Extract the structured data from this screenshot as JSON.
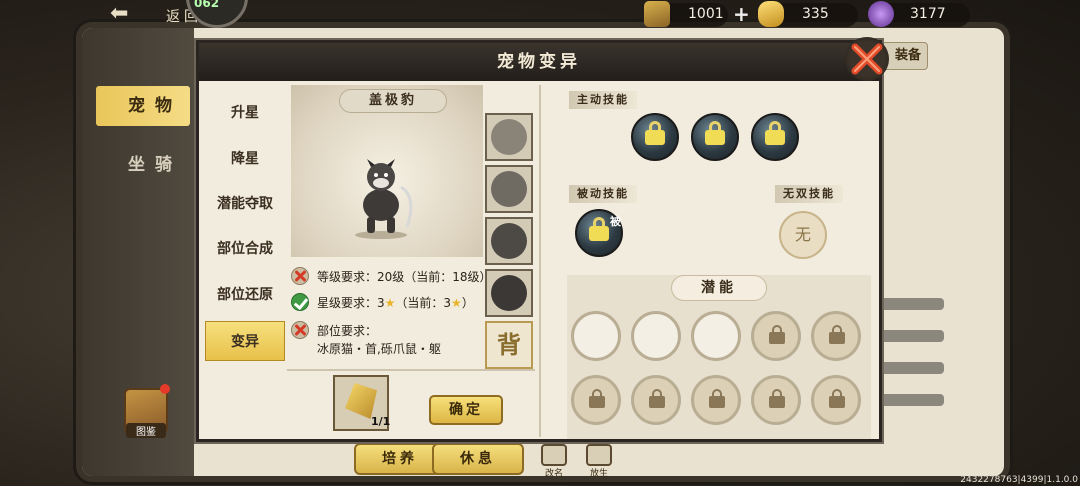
{
  "hud": {
    "back_label": "返回",
    "level_badge": "062",
    "resources": [
      {
        "name": "scroll-currency",
        "value": "1001"
      },
      {
        "name": "gold-ingot",
        "value": "335"
      },
      {
        "name": "purple-orb",
        "value": "3177"
      }
    ]
  },
  "book": {
    "tabs": [
      {
        "label": "宠物",
        "active": true
      },
      {
        "label": "坐骑",
        "active": false
      }
    ],
    "right_tab": "装备",
    "codex_label": "图鉴",
    "bottom_buttons": [
      "培养",
      "休息"
    ],
    "mini_icons": [
      "改名",
      "放生"
    ]
  },
  "modal": {
    "title": "宠物变异",
    "menu": [
      {
        "label": "升星",
        "active": false
      },
      {
        "label": "降星",
        "active": false
      },
      {
        "label": "潜能夺取",
        "active": false
      },
      {
        "label": "部位合成",
        "active": false
      },
      {
        "label": "部位还原",
        "active": false
      },
      {
        "label": "变异",
        "active": true
      }
    ],
    "pet_name": "盖极豹",
    "part_thumbs": [
      "head",
      "body",
      "limbs",
      "tail",
      "背"
    ],
    "requirements": [
      {
        "status": "fail",
        "text": "等级要求：20级（当前：18级）"
      },
      {
        "status": "pass",
        "text_before": "星级要求：3",
        "text_mid": "（当前：3",
        "text_after": "）"
      },
      {
        "status": "fail",
        "text": "部位要求：",
        "text2": "冰原猫・首,砾爪鼠・躯"
      }
    ],
    "material_count": "1/1",
    "confirm_label": "确定",
    "active_skills_label": "主动技能",
    "passive_skills_label": "被动技能",
    "unique_skills_label": "无双技能",
    "passive_mark": "被",
    "unique_none": "无",
    "potential_label": "潜能"
  },
  "footer": {
    "version": "2432278763|4399|1.1.0.0"
  },
  "colors": {
    "accent_gold": "#e8c14a",
    "header_dark": "#2a2520",
    "fail_red": "#d43a26",
    "pass_green": "#3f9a44"
  }
}
